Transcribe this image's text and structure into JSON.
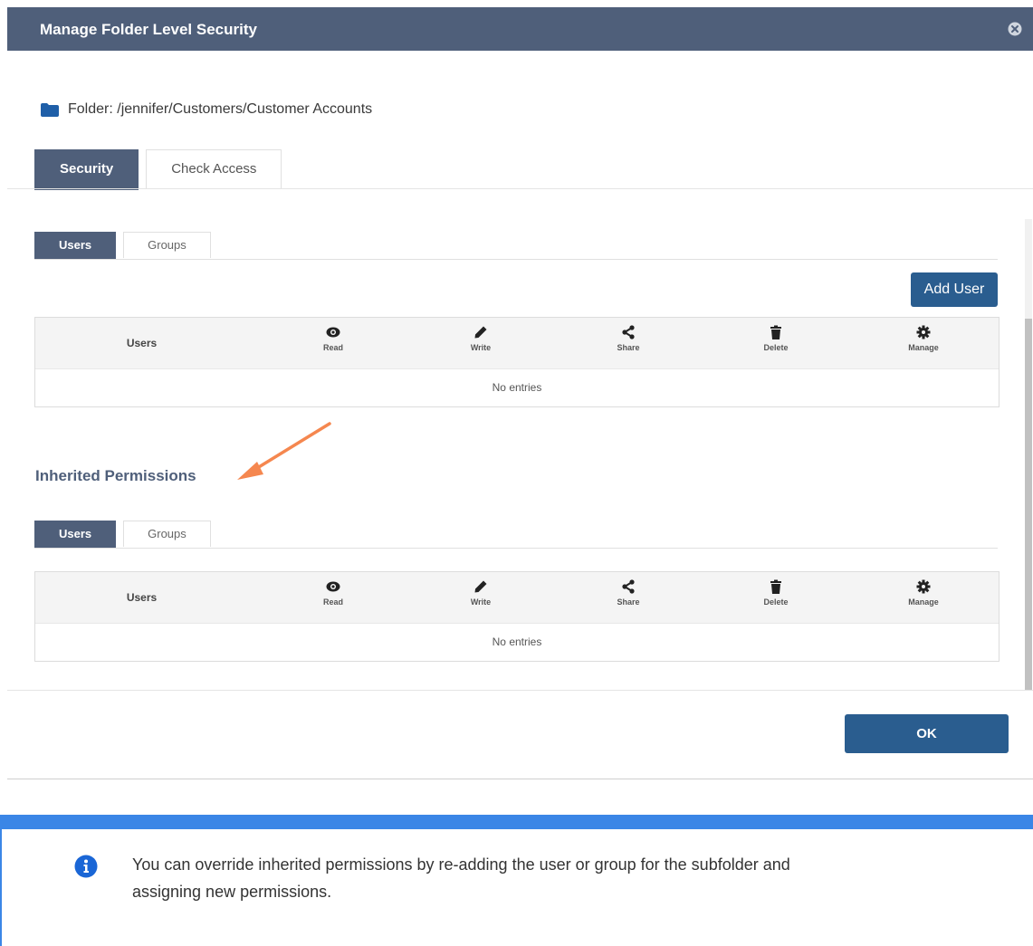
{
  "dialog": {
    "title": "Manage Folder Level Security",
    "folder_label": "Folder: /jennifer/Customers/Customer Accounts",
    "tabs": [
      {
        "label": "Security"
      },
      {
        "label": "Check Access"
      }
    ],
    "ok_label": "OK"
  },
  "explicit": {
    "subtabs": [
      {
        "label": "Users"
      },
      {
        "label": "Groups"
      }
    ],
    "add_user_label": "Add User",
    "table": {
      "users_header": "Users",
      "columns": [
        {
          "label": "Read",
          "icon": "eye-icon"
        },
        {
          "label": "Write",
          "icon": "pencil-icon"
        },
        {
          "label": "Share",
          "icon": "share-icon"
        },
        {
          "label": "Delete",
          "icon": "trash-icon"
        },
        {
          "label": "Manage",
          "icon": "gear-icon"
        }
      ],
      "empty_text": "No entries"
    }
  },
  "inherited": {
    "title": "Inherited Permissions",
    "subtabs": [
      {
        "label": "Users"
      },
      {
        "label": "Groups"
      }
    ],
    "table": {
      "users_header": "Users",
      "columns": [
        {
          "label": "Read",
          "icon": "eye-icon"
        },
        {
          "label": "Write",
          "icon": "pencil-icon"
        },
        {
          "label": "Share",
          "icon": "share-icon"
        },
        {
          "label": "Delete",
          "icon": "trash-icon"
        },
        {
          "label": "Manage",
          "icon": "gear-icon"
        }
      ],
      "empty_text": "No entries"
    }
  },
  "note": {
    "text": "You can override inherited permissions by re-adding the user or group for the subfolder and assigning new permissions.",
    "icon": "info-icon"
  },
  "colors": {
    "header_bg": "#4f5f7a",
    "primary_button": "#2a5d8f",
    "arrow": "#f5874f",
    "note_accent": "#3b86e6"
  }
}
